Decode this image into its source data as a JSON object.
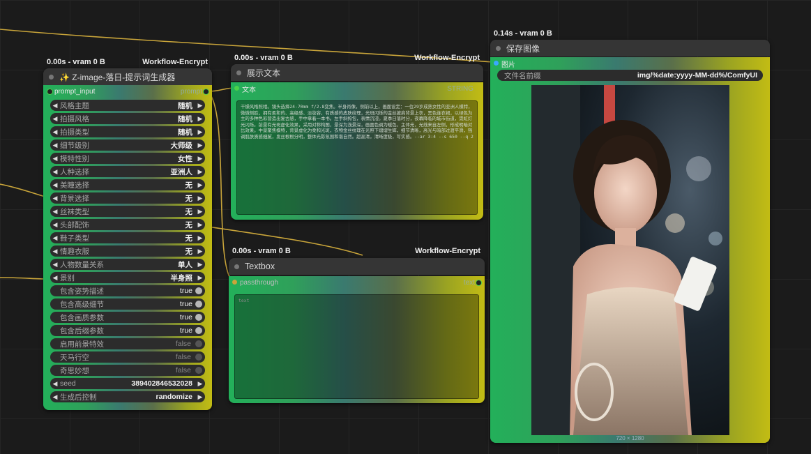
{
  "colors": {
    "socket_green": "#4ad14a",
    "socket_blue": "#3aa8ff",
    "wire": "#c9a53a"
  },
  "node1": {
    "stats_time": "0.00s - vram 0 B",
    "stats_tag": "Workflow-Encrypt",
    "title": "✨ Z-image-落日-提示词生成器",
    "input_label": "prompt_input",
    "output_label": "prompt",
    "widgets": [
      {
        "label": "风格主题",
        "value": "随机",
        "kind": "combo"
      },
      {
        "label": "拍摄风格",
        "value": "随机",
        "kind": "combo"
      },
      {
        "label": "拍摄类型",
        "value": "随机",
        "kind": "combo"
      },
      {
        "label": "细节级别",
        "value": "大师级",
        "kind": "combo"
      },
      {
        "label": "模特性别",
        "value": "女性",
        "kind": "combo"
      },
      {
        "label": "人种选择",
        "value": "亚洲人",
        "kind": "combo"
      },
      {
        "label": "美瞳选择",
        "value": "无",
        "kind": "combo"
      },
      {
        "label": "背景选择",
        "value": "无",
        "kind": "combo"
      },
      {
        "label": "丝袜类型",
        "value": "无",
        "kind": "combo"
      },
      {
        "label": "头部配饰",
        "value": "无",
        "kind": "combo"
      },
      {
        "label": "鞋子类型",
        "value": "无",
        "kind": "combo"
      },
      {
        "label": "情趣衣服",
        "value": "无",
        "kind": "combo"
      },
      {
        "label": "人物数量关系",
        "value": "单人",
        "kind": "combo"
      },
      {
        "label": "景别",
        "value": "半身照",
        "kind": "combo"
      },
      {
        "label": "包含姿势描述",
        "value": "true",
        "kind": "toggle_on"
      },
      {
        "label": "包含高级细节",
        "value": "true",
        "kind": "toggle_on"
      },
      {
        "label": "包含画质参数",
        "value": "true",
        "kind": "toggle_on"
      },
      {
        "label": "包含后缀参数",
        "value": "true",
        "kind": "toggle_on"
      },
      {
        "label": "启用前景特效",
        "value": "false",
        "kind": "toggle_off"
      },
      {
        "label": "天马行空",
        "value": "false",
        "kind": "toggle_off"
      },
      {
        "label": "奇思妙想",
        "value": "false",
        "kind": "toggle_off"
      },
      {
        "label": "seed",
        "value": "389402846532028",
        "kind": "combo"
      },
      {
        "label": "生成后控制",
        "value": "randomize",
        "kind": "combo"
      }
    ]
  },
  "node2": {
    "stats_time": "0.00s - vram 0 B",
    "stats_tag": "Workflow-Encrypt",
    "title": "展示文本",
    "input_label": "文本",
    "output_label": "STRING",
    "text": "干燥风格照相。镜头选择24-70mm f/2.8变焦。半身肖像，侧前以上，画面设定：一位29岁成熟女性的亚洲人模特，微微侧脸，拥有柔和的、高级感、淡妆容，有质感的皮肤纹理，光斑闪烁的金丝披肩背景上衣，黑色连衣裙，以绿色为主的多种色彩营造出复古感，手中拿着一本书。左手斜挎包，表情沉浸。夏季日落时分，夜幕降临的城市街道，霓虹灯光闪烁。前景有光斑虚化效果，采用对称构图，景深为浅景深，画面色调为暖色，主体光，光线来自左侧，形成明暗对比效果。中景聚焦模特，背景虚化为柔和光斑，衣物金丝纹理在光照下熠熠生辉，细节清晰，高光与暗部过渡平滑，强调肌肤质感细腻，发丝根根分明，整体光影氛围和谐自然。超高清，清晰度极，写实感。--ar 3:4 --s 650 --q 2"
  },
  "node3": {
    "stats_time": "0.00s - vram 0 B",
    "stats_tag": "Workflow-Encrypt",
    "title": "Textbox",
    "input_label": "passthrough",
    "output_label": "text",
    "placeholder": "text"
  },
  "node4": {
    "stats_time": "0.14s - vram 0 B",
    "title": "保存图像",
    "input_label": "图片",
    "prefix_label": "文件名前缀",
    "prefix_value": "img/%date:yyyy-MM-dd%/ComfyUI",
    "image_size": "720 × 1280"
  }
}
